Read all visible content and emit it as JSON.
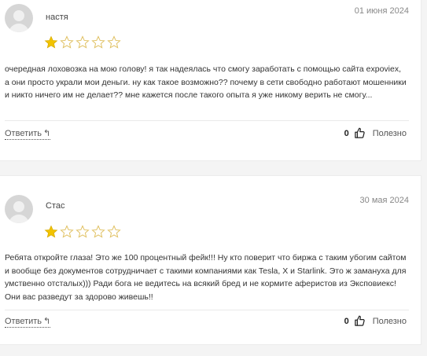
{
  "reviews": [
    {
      "author": "настя",
      "date": "01 июня 2024",
      "rating": 1,
      "max_rating": 5,
      "text": "очередная лоховозка на мою голову! я так надеялась что смогу заработать с помощью сайта expoviex, а они просто украли мои деньги. ну как такое возможно?? почему в сети свободно работают мошенники и никто ничего им не делает?? мне кажется после такого опыта я уже никому верить не смогу...",
      "reply_label": "Ответить",
      "likes": "0",
      "useful_label": "Полезно"
    },
    {
      "author": "Стас",
      "date": "30 мая 2024",
      "rating": 1,
      "max_rating": 5,
      "text": "Ребята откройте глаза! Это же 100 процентный фейк!!! Ну кто поверит что биржа с таким убогим сайтом и вообще без документов сотрудничает с такими компаниями как Tesla, X и Starlink. Это ж заманухa для умственно отсталых))) Ради бога не ведитесь на всякий бред и не кормите аферистов из Эксповиекс! Они вас разведут за здорово живешь!!",
      "reply_label": "Ответить",
      "likes": "0",
      "useful_label": "Полезно"
    }
  ],
  "colors": {
    "star_filled": "#f2c300",
    "star_empty": "#e0c060"
  },
  "icons": {
    "reply": "reply-arrow-icon",
    "like": "thumbs-up-icon",
    "star": "star-icon"
  }
}
